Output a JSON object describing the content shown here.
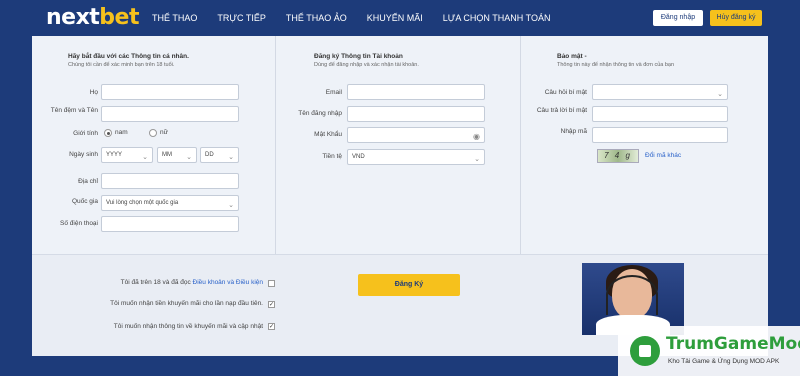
{
  "brand": {
    "next": "next",
    "bet": "bet"
  },
  "nav": [
    "THỂ THAO",
    "TRỰC TIẾP",
    "THỂ THAO ẢO",
    "KHUYẾN MÃI",
    "LỰA CHỌN THANH TOÁN"
  ],
  "header": {
    "login_label": "Đăng nhập",
    "cancel_label": "Hủy đăng ký"
  },
  "personal": {
    "title": "Hãy bắt đầu với các Thông tin cá nhân.",
    "subtitle": "Chúng tôi cần để xác minh bạn trên 18 tuổi.",
    "last_name_label": "Họ",
    "middle_name_label": "Tên đệm và Tên",
    "gender_label": "Giới tính",
    "male_label": "nam",
    "female_label": "nữ",
    "dob_label": "Ngày sinh",
    "year_placeholder": "YYYY",
    "month_placeholder": "MM",
    "day_placeholder": "DD",
    "address_label": "Địa chỉ",
    "country_label": "Quốc gia",
    "country_value": "Vui lòng chọn một quốc gia",
    "phone_label": "Số điện thoại"
  },
  "account": {
    "title": "Đăng ký Thông tin Tài khoản",
    "subtitle": "Dùng để đăng nhập và xác nhận tài khoản.",
    "email_label": "Email",
    "username_label": "Tên đăng nhập",
    "password_label": "Mật Khẩu",
    "currency_label": "Tiền tệ",
    "currency_value": "VND"
  },
  "security": {
    "title": "Bảo mật -",
    "subtitle": "Thông tin này để nhận thông tin và đơn của bạn",
    "question_label": "Câu hỏi bí mật",
    "answer_label": "Câu trả lời bí mật",
    "code_label": "Nhập mã",
    "captcha_text": "7 4 g",
    "refresh_label": "Đổi mã khác"
  },
  "terms": {
    "age_prefix": "Tôi đã trên 18 và đã đọc ",
    "age_link": "Điều khoản và Điều kiện",
    "age_checked": false,
    "bonus_label": "Tôi muốn nhận tiền khuyến mãi cho lần nạp đầu tiên.",
    "bonus_checked": true,
    "news_label": "Tôi muốn nhận thông tin về khuyến mãi và cập nhật",
    "news_checked": true
  },
  "register_label": "Đăng Ký",
  "watermark": {
    "title": "TrumGameMod",
    "subtitle": "Kho Tải Game & Ứng Dụng MOD APK"
  },
  "colors": {
    "navy": "#1d3b7a",
    "yellow": "#f6c11c",
    "link": "#2a62c9"
  }
}
